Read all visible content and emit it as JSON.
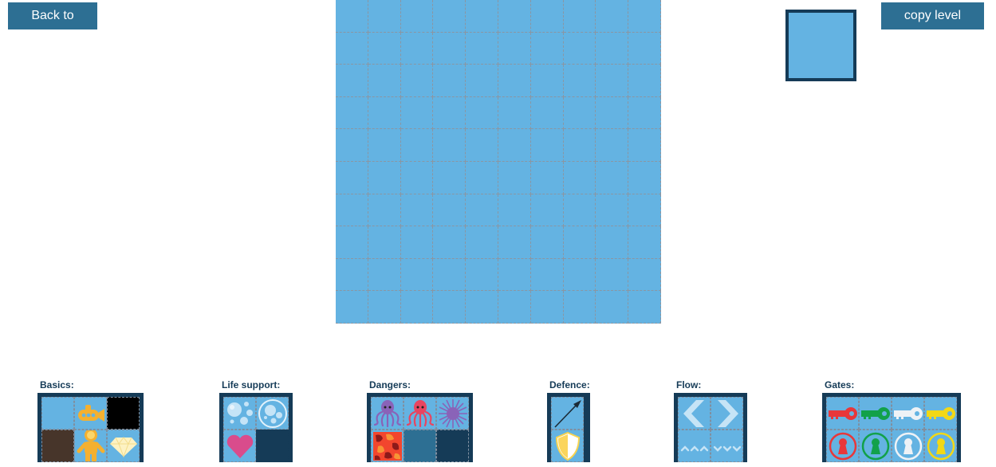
{
  "toolbar": {
    "back_label": "Back to menu",
    "copy_label": "copy level string"
  },
  "editor": {
    "grid_columns": 10,
    "grid_rows": 10,
    "selected_tile": "water"
  },
  "palettes": [
    {
      "label": "Basics:",
      "tiles": [
        "water",
        "submarine",
        "wall-black",
        "rock-brown",
        "diver",
        "diamond"
      ]
    },
    {
      "label": "Life support:",
      "tiles": [
        "air-bubbles",
        "bubble-ring",
        "heart",
        "empty"
      ]
    },
    {
      "label": "Dangers:",
      "tiles": [
        "octopus-purple",
        "octopus-red",
        "sea-urchin",
        "lava",
        "deep-water",
        "empty"
      ]
    },
    {
      "label": "Defence:",
      "tiles": [
        "harpoon",
        "shield"
      ]
    },
    {
      "label": "Flow:",
      "tiles": [
        "current-left",
        "current-right",
        "current-up",
        "current-down"
      ]
    },
    {
      "label": "Gates:",
      "tiles": [
        "key-red",
        "key-green",
        "key-white",
        "key-yellow",
        "lock-red",
        "lock-green",
        "lock-white",
        "lock-yellow"
      ]
    }
  ],
  "colors": {
    "button": "#2d6f93",
    "water": "#64b3e2",
    "frame": "#153b57",
    "red": "#e8373a",
    "green": "#12a14a",
    "white": "#eef2f6",
    "yellow": "#f2d816"
  }
}
